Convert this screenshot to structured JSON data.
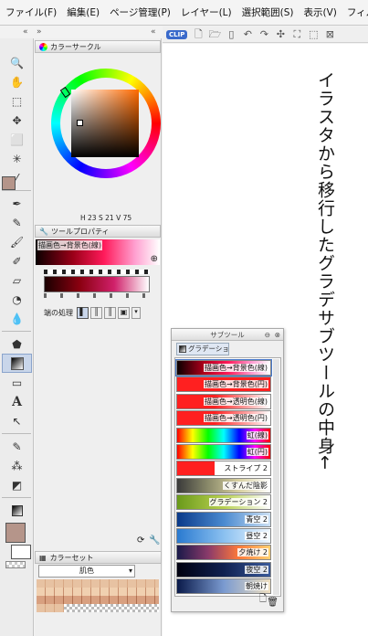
{
  "menu": [
    "ファイル(F)",
    "編集(E)",
    "ページ管理(P)",
    "レイヤー(L)",
    "選択範囲(S)",
    "表示(V)",
    "フィルター(I)"
  ],
  "toolbar": {
    "logo": "CLIP"
  },
  "color_circle": {
    "tab_label": "カラーサークル",
    "value_h": "23",
    "value_s": "21",
    "value_v": "75",
    "prefix_h": "H",
    "prefix_s": "S",
    "prefix_v": "V"
  },
  "tool_property": {
    "tab_label": "ツールプロパティ",
    "gradient_name": "描画色→背景色(線)",
    "edge_label": "端の処理"
  },
  "color_set": {
    "tab_label": "カラーセット",
    "selected": "肌色"
  },
  "subtool": {
    "title": "サブツール",
    "tab": "グラデーション",
    "items": [
      {
        "label": "描画色→背景色(線)",
        "bg": "linear-gradient(90deg,#0a0000 0%,#b5001c 30%,#ff1a5a 55%,#ff9ad0 80%,#fff 100%)"
      },
      {
        "label": "描画色→背景色(円)",
        "bg": "linear-gradient(90deg,#ff2020,#ff2020)"
      },
      {
        "label": "描画色→透明色(線)",
        "bg": "linear-gradient(90deg,#ff2020 0%,#ff2020 40%,#fff 100%)"
      },
      {
        "label": "描画色→透明色(円)",
        "bg": "linear-gradient(90deg,#ff2020 0%,#ff2020 40%,#fff 100%)"
      },
      {
        "label": "虹(線)",
        "bg": "linear-gradient(90deg,#ff0000,#ffff00,#00ff00,#00ffff,#0000ff,#ff00ff,#ff0000)"
      },
      {
        "label": "虹(円)",
        "bg": "linear-gradient(90deg,#ff0000,#ffff00,#00ff00,#00ffff,#0000ff,#ff00ff,#ff0000)"
      },
      {
        "label": "ストライプ 2",
        "bg": "linear-gradient(90deg,#ff2020 0%,#ff2020 40%,#fff 40%,#fff 100%)"
      },
      {
        "label": "くすんだ陰影",
        "bg": "linear-gradient(90deg,#3a3a3a,#8a8a6a,#d8d0a0,#fff)"
      },
      {
        "label": "グラデーション 2",
        "bg": "linear-gradient(90deg,#6a9a1a,#b8d050,#fff)"
      },
      {
        "label": "青空 2",
        "bg": "linear-gradient(90deg,#0a3a8a,#4a8ad0,#cce0f4)"
      },
      {
        "label": "昼空 2",
        "bg": "linear-gradient(90deg,#2a7ad0,#8ac0f0,#f0f8ff)"
      },
      {
        "label": "夕焼け 2",
        "bg": "linear-gradient(90deg,#1a1a4a,#8a3a6a,#ff7a3a,#ffd070)"
      },
      {
        "label": "夜空 2",
        "bg": "linear-gradient(90deg,#000010,#102050,#3a5a9a)"
      },
      {
        "label": "朝焼け",
        "bg": "linear-gradient(90deg,#0a1a4a,#7a9ad0,#f0e0c0)"
      }
    ]
  },
  "canvas_text": "イラスタから移行したグラデサブツールの中身←"
}
